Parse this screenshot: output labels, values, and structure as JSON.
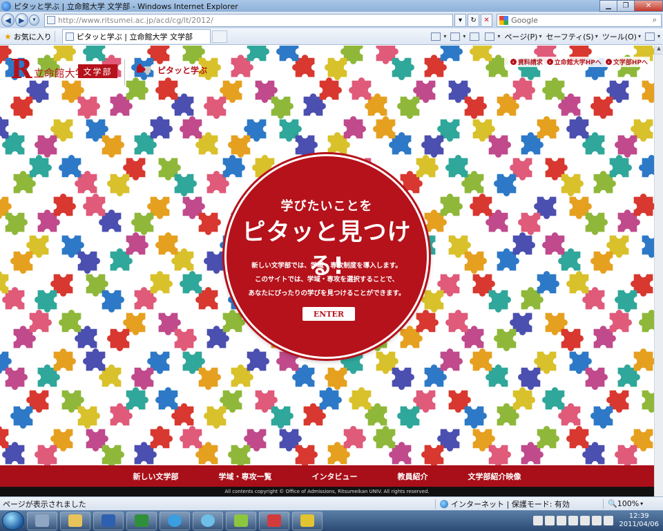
{
  "window": {
    "title": "ピタッと学ぶ | 立命館大学 文学部 - Windows Internet Explorer"
  },
  "address": {
    "url": "http://www.ritsumei.ac.jp/acd/cg/lt/2012/",
    "search_placeholder": "Google"
  },
  "favorites": {
    "label": "お気に入り",
    "tab_title": "ピタッと学ぶ | 立命館大学 文学部"
  },
  "commands": [
    {
      "label": "ページ(P)"
    },
    {
      "label": "セーフティ(S)"
    },
    {
      "label": "ツール(O)"
    }
  ],
  "site": {
    "university": "立命館大学",
    "department": "文学部",
    "brand": "ピタッと学ぶ",
    "top_links": [
      "資料請求",
      "立命館大学HPへ",
      "文学部HPへ"
    ]
  },
  "hero": {
    "line_small": "学びたいことを",
    "line_big": "ピタッと見つける!",
    "body": [
      "新しい文学部では、学域・専攻制度を導入します。",
      "このサイトでは、学域・専攻を選択することで、",
      "あなたにぴったりの学びを見つけることができます。"
    ],
    "enter_label": "ENTER"
  },
  "bottom_nav": [
    "新しい文学部",
    "学域・専攻一覧",
    "インタビュー",
    "教員紹介",
    "文学部紹介映像"
  ],
  "copyright": "All contents copyright © Office of Admissions, Ritsumeikan UNIV. All rights reserved.",
  "status": {
    "text": "ページが表示されました",
    "zone": "インターネット | 保護モード: 有効",
    "zoom": "100%"
  },
  "clock": {
    "time": "12:39",
    "date": "2011/04/06"
  },
  "colors": {
    "brand_red": "#b5121b",
    "piece_colors": [
      "#d8382f",
      "#e6a020",
      "#2d79c7",
      "#8fb83a",
      "#c04a8c",
      "#2fa79a",
      "#e05a7a",
      "#4b4fb0",
      "#d9c12b"
    ]
  }
}
